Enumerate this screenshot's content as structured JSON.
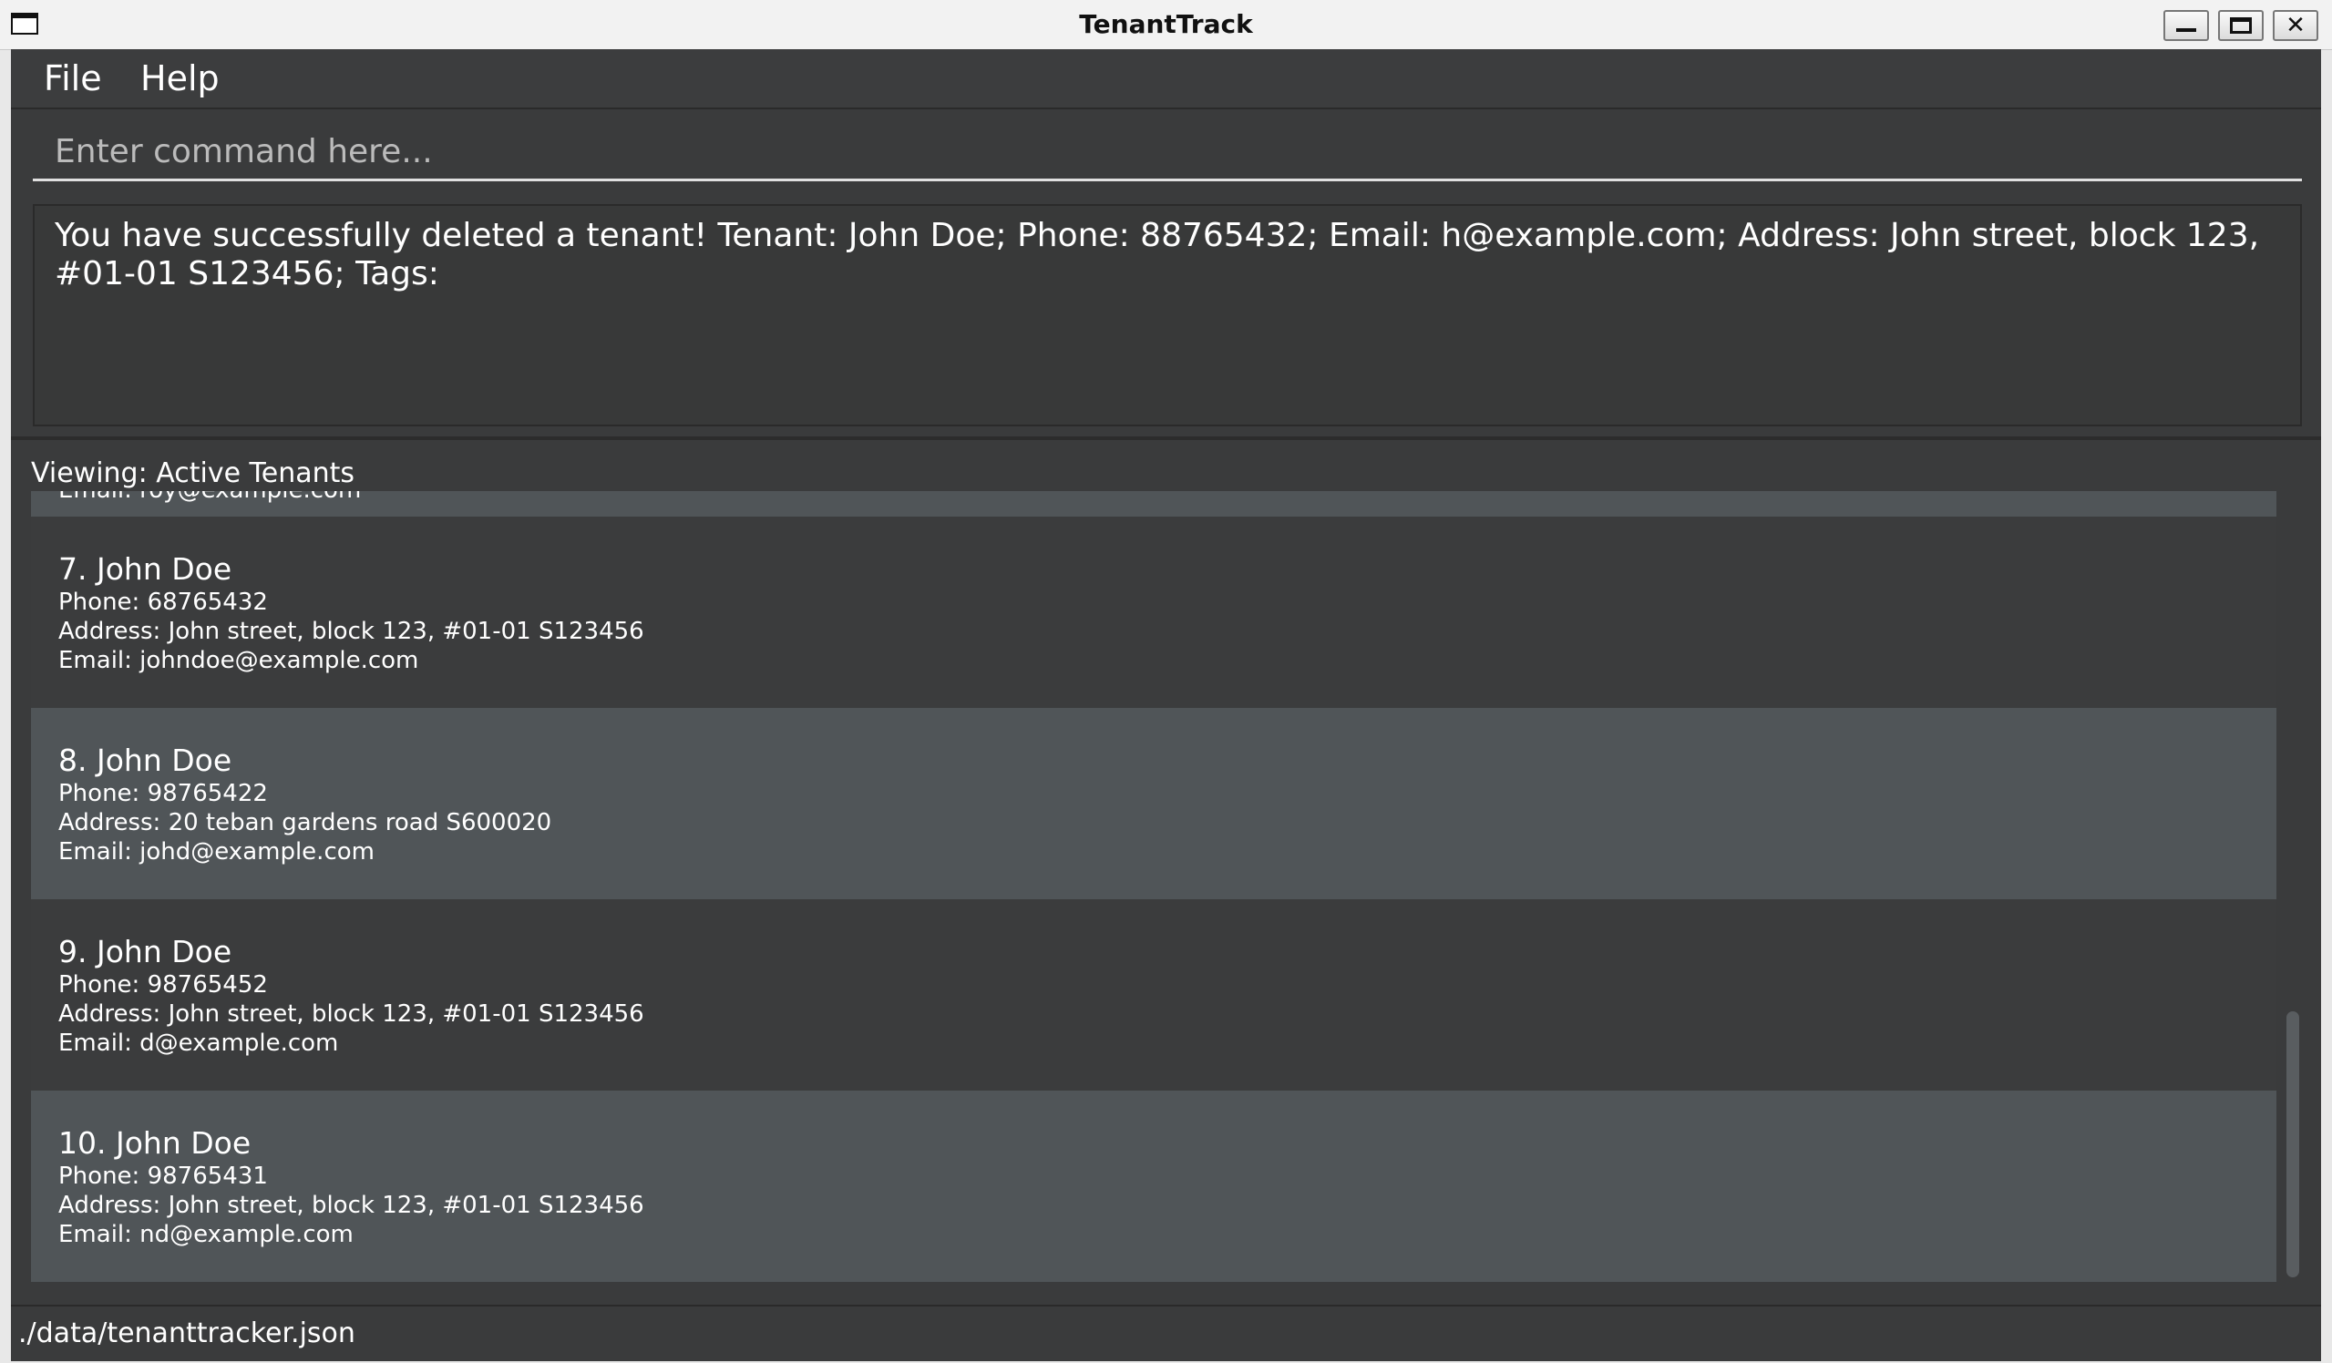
{
  "window": {
    "title": "TenantTrack",
    "controls": {
      "minimize": "_",
      "maximize": "□",
      "close": "✕"
    }
  },
  "menu": {
    "file": "File",
    "help": "Help"
  },
  "command": {
    "placeholder": "Enter command here...",
    "value": ""
  },
  "result": {
    "message": "You have successfully deleted a tenant! Tenant: John Doe; Phone: 88765432; Email: h@example.com; Address: John street, block 123, #01-01 S123456; Tags:"
  },
  "list": {
    "viewing_label": "Viewing: Active Tenants",
    "partial_email": "Email: roy@example.com",
    "tenants": [
      {
        "index": "7.",
        "name": "John Doe",
        "phone": "Phone: 68765432",
        "address": "Address: John street, block 123, #01-01 S123456",
        "email": "Email: johndoe@example.com"
      },
      {
        "index": "8.",
        "name": "John Doe",
        "phone": "Phone: 98765422",
        "address": "Address: 20 teban gardens road S600020",
        "email": "Email: johd@example.com"
      },
      {
        "index": "9.",
        "name": "John Doe",
        "phone": "Phone: 98765452",
        "address": "Address: John street, block 123, #01-01 S123456",
        "email": "Email: d@example.com"
      },
      {
        "index": "10.",
        "name": "John Doe",
        "phone": "Phone: 98765431",
        "address": "Address: John street, block 123, #01-01 S123456",
        "email": "Email: nd@example.com"
      }
    ]
  },
  "status": {
    "file_path": "./data/tenanttracker.json"
  },
  "colors": {
    "background": "#3a3b3c",
    "card_dark": "#3b3c3d",
    "card_light": "#505558",
    "text": "#ffffff"
  }
}
